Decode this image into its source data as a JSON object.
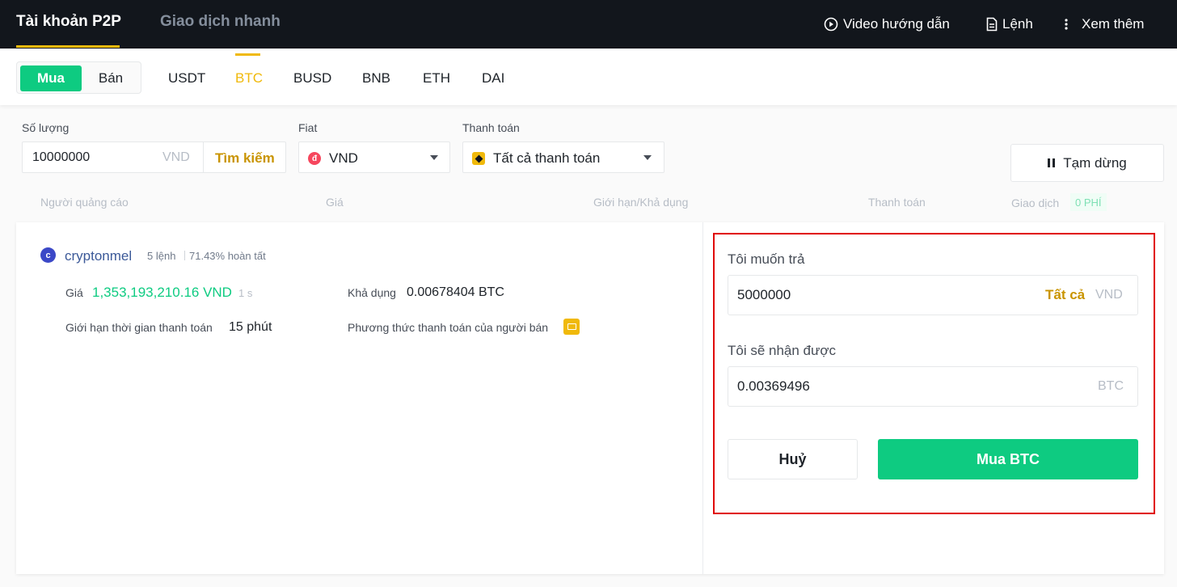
{
  "header": {
    "tabs": [
      {
        "label": "Tài khoản P2P"
      },
      {
        "label": "Giao dịch nhanh"
      }
    ],
    "links": {
      "video": "Video hướng dẫn",
      "orders": "Lệnh",
      "more": "Xem thêm"
    }
  },
  "trade_toggle": {
    "buy": "Mua",
    "sell": "Bán"
  },
  "assets": [
    "USDT",
    "BTC",
    "BUSD",
    "BNB",
    "ETH",
    "DAI"
  ],
  "filters": {
    "amount_label": "Số lượng",
    "amount_value": "10000000",
    "amount_unit": "VND",
    "search_label": "Tìm kiếm",
    "fiat_label": "Fiat",
    "fiat_value": "VND",
    "fiat_icon_glyph": "đ",
    "payment_label": "Thanh toán",
    "payment_value": "Tất cả thanh toán",
    "pause_label": "Tạm dừng"
  },
  "table_header": {
    "advertiser": "Người quảng cáo",
    "price": "Giá",
    "limit": "Giới hạn/Khả dụng",
    "payment": "Thanh toán",
    "trade": "Giao dịch",
    "zero_fee": "0 PHÍ"
  },
  "ad": {
    "avatar_letter": "c",
    "name": "cryptonmel",
    "orders": "5 lệnh",
    "completion": "71.43% hoàn tất",
    "price_label": "Giá",
    "price_value": "1,353,193,210.16 VND",
    "price_age": "1 s",
    "available_label": "Khả dụng",
    "available_value": "0.00678404 BTC",
    "time_limit_label": "Giới hạn thời gian thanh toán",
    "time_limit_value": "15 phút",
    "method_label": "Phương thức thanh toán của người bán"
  },
  "order_form": {
    "pay_label": "Tôi muốn trả",
    "pay_value": "5000000",
    "pay_all": "Tất cả",
    "pay_unit": "VND",
    "receive_label": "Tôi sẽ nhận được",
    "receive_value": "0.00369496",
    "receive_unit": "BTC",
    "cancel_label": "Huỷ",
    "buy_label": "Mua BTC"
  },
  "colors": {
    "accent": "#f0b90b",
    "buy_green": "#0ecb81",
    "highlight_red": "#e00000",
    "header_bg": "#12161c"
  }
}
